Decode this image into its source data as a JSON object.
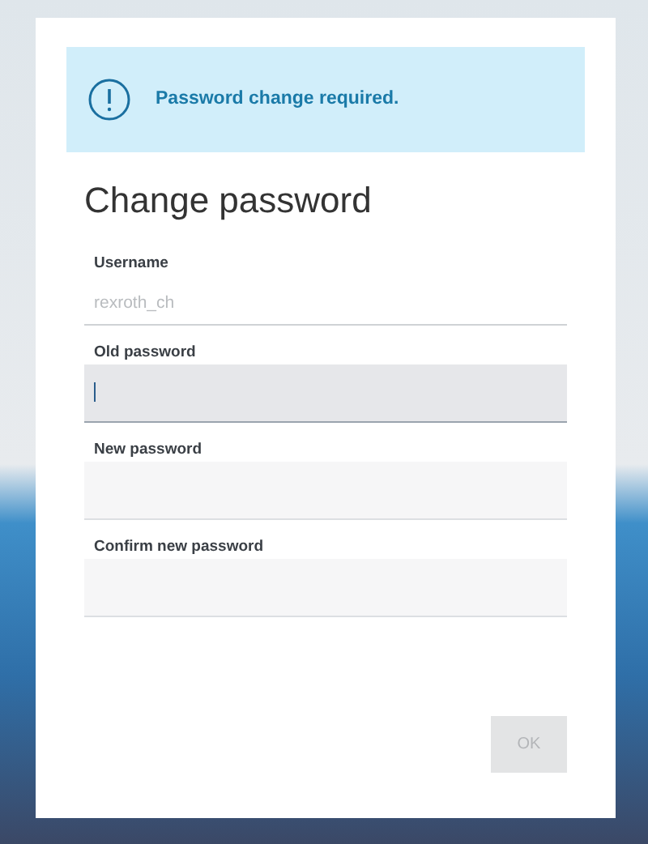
{
  "alert": {
    "text": "Password change required."
  },
  "title": "Change password",
  "fields": [
    {
      "kind": "readonly",
      "label": "Username",
      "value": "rexroth_ch"
    },
    {
      "kind": "password",
      "label": "Old password",
      "focused": true
    },
    {
      "kind": "password",
      "label": "New password",
      "focused": false
    },
    {
      "kind": "password",
      "label": "Confirm new password",
      "focused": false
    }
  ],
  "ok_button": {
    "label": "OK",
    "disabled": true
  }
}
